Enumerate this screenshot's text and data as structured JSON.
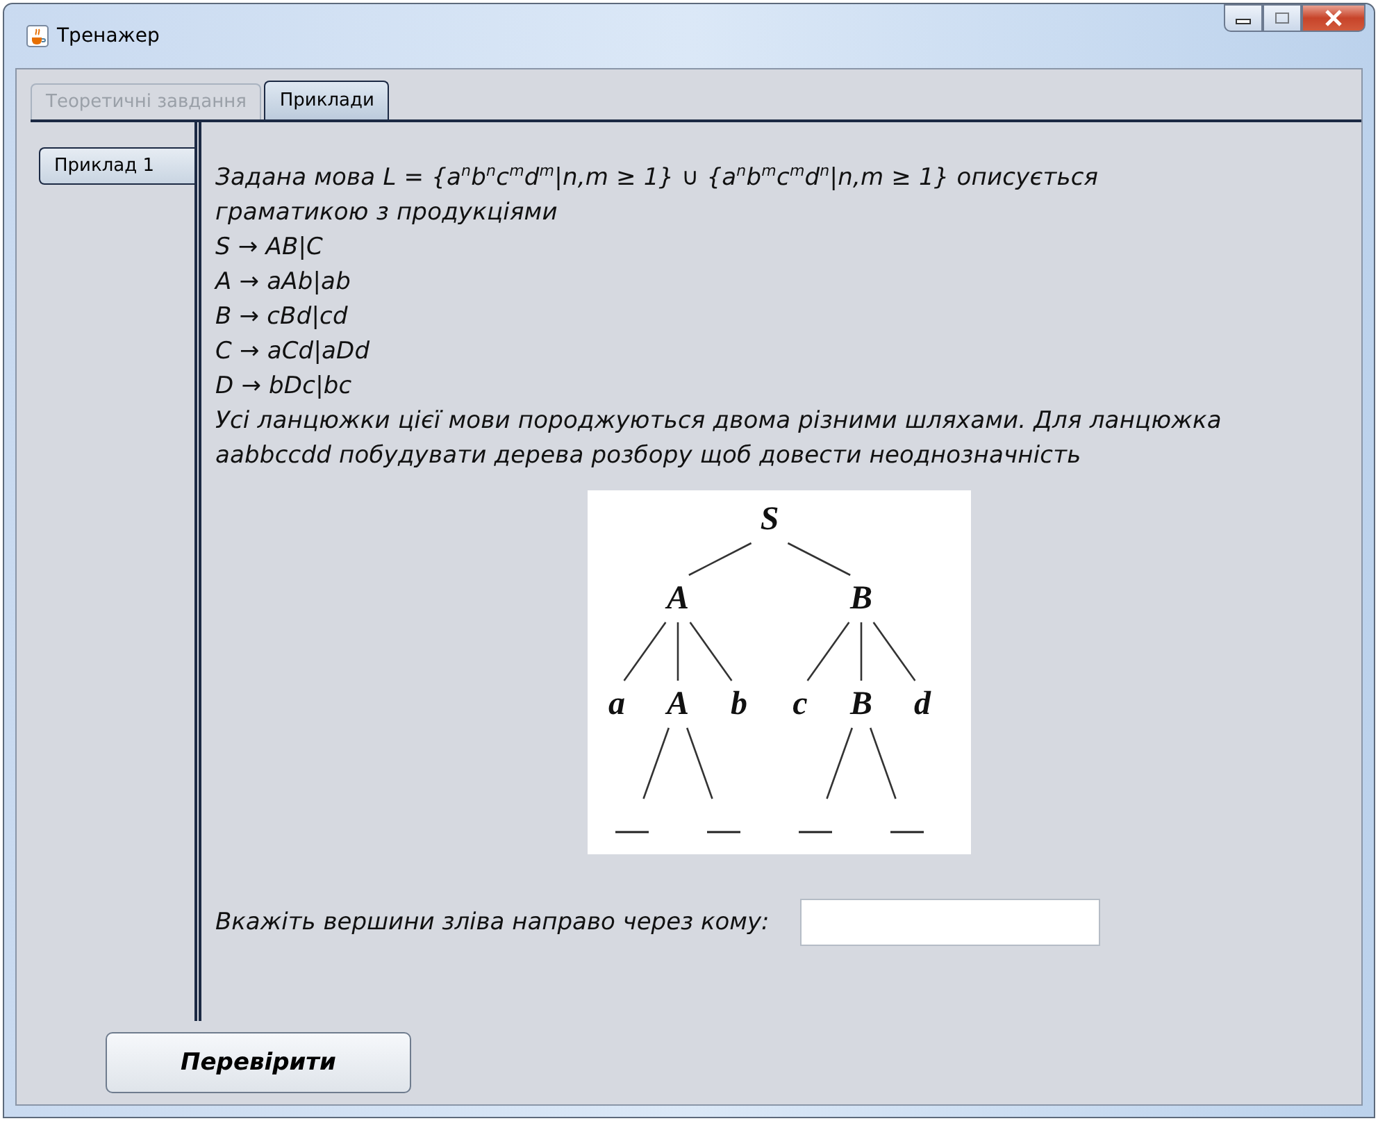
{
  "window": {
    "title": "Тренажер"
  },
  "tabs": [
    {
      "label": "Теоретичні завдання",
      "selected": false,
      "disabled": true
    },
    {
      "label": "Приклади",
      "selected": true,
      "disabled": false
    }
  ],
  "side_tabs": [
    {
      "label": "Приклад 1",
      "selected": true
    }
  ],
  "task": {
    "lines": [
      "Задана мова L = {a$^{n}$b$^{n}$c$^{m}$d$^{m}$|n,m ≥ 1} ∪ {a$^{n}$b$^{m}$c$^{m}$d$^{n}$|n,m ≥ 1} описується граматикою з продукціями",
      "S → AB|C",
      "A → aAb|ab",
      "B → cBd|cd",
      "C → aCd|aDd",
      "D → bDc|bc",
      "Усі ланцюжки цієї мови породжуються двома різними шляхами. Для ланцюжка aabbccdd побудувати дерева розбору щоб довести неоднозначність"
    ]
  },
  "tree": {
    "kind": "node",
    "label": "S",
    "children": [
      {
        "kind": "node",
        "label": "A",
        "children": [
          {
            "kind": "node",
            "label": "a"
          },
          {
            "kind": "node",
            "label": "A",
            "children": [
              {
                "kind": "blank"
              },
              {
                "kind": "blank"
              }
            ]
          },
          {
            "kind": "node",
            "label": "b"
          }
        ]
      },
      {
        "kind": "node",
        "label": "B",
        "children": [
          {
            "kind": "node",
            "label": "c"
          },
          {
            "kind": "node",
            "label": "B",
            "children": [
              {
                "kind": "blank"
              },
              {
                "kind": "blank"
              }
            ]
          },
          {
            "kind": "node",
            "label": "d"
          }
        ]
      }
    ]
  },
  "answer": {
    "prompt": "Вкажіть вершини зліва направо через кому:"
  },
  "buttons": [
    {
      "label": "Перевірити"
    }
  ]
}
